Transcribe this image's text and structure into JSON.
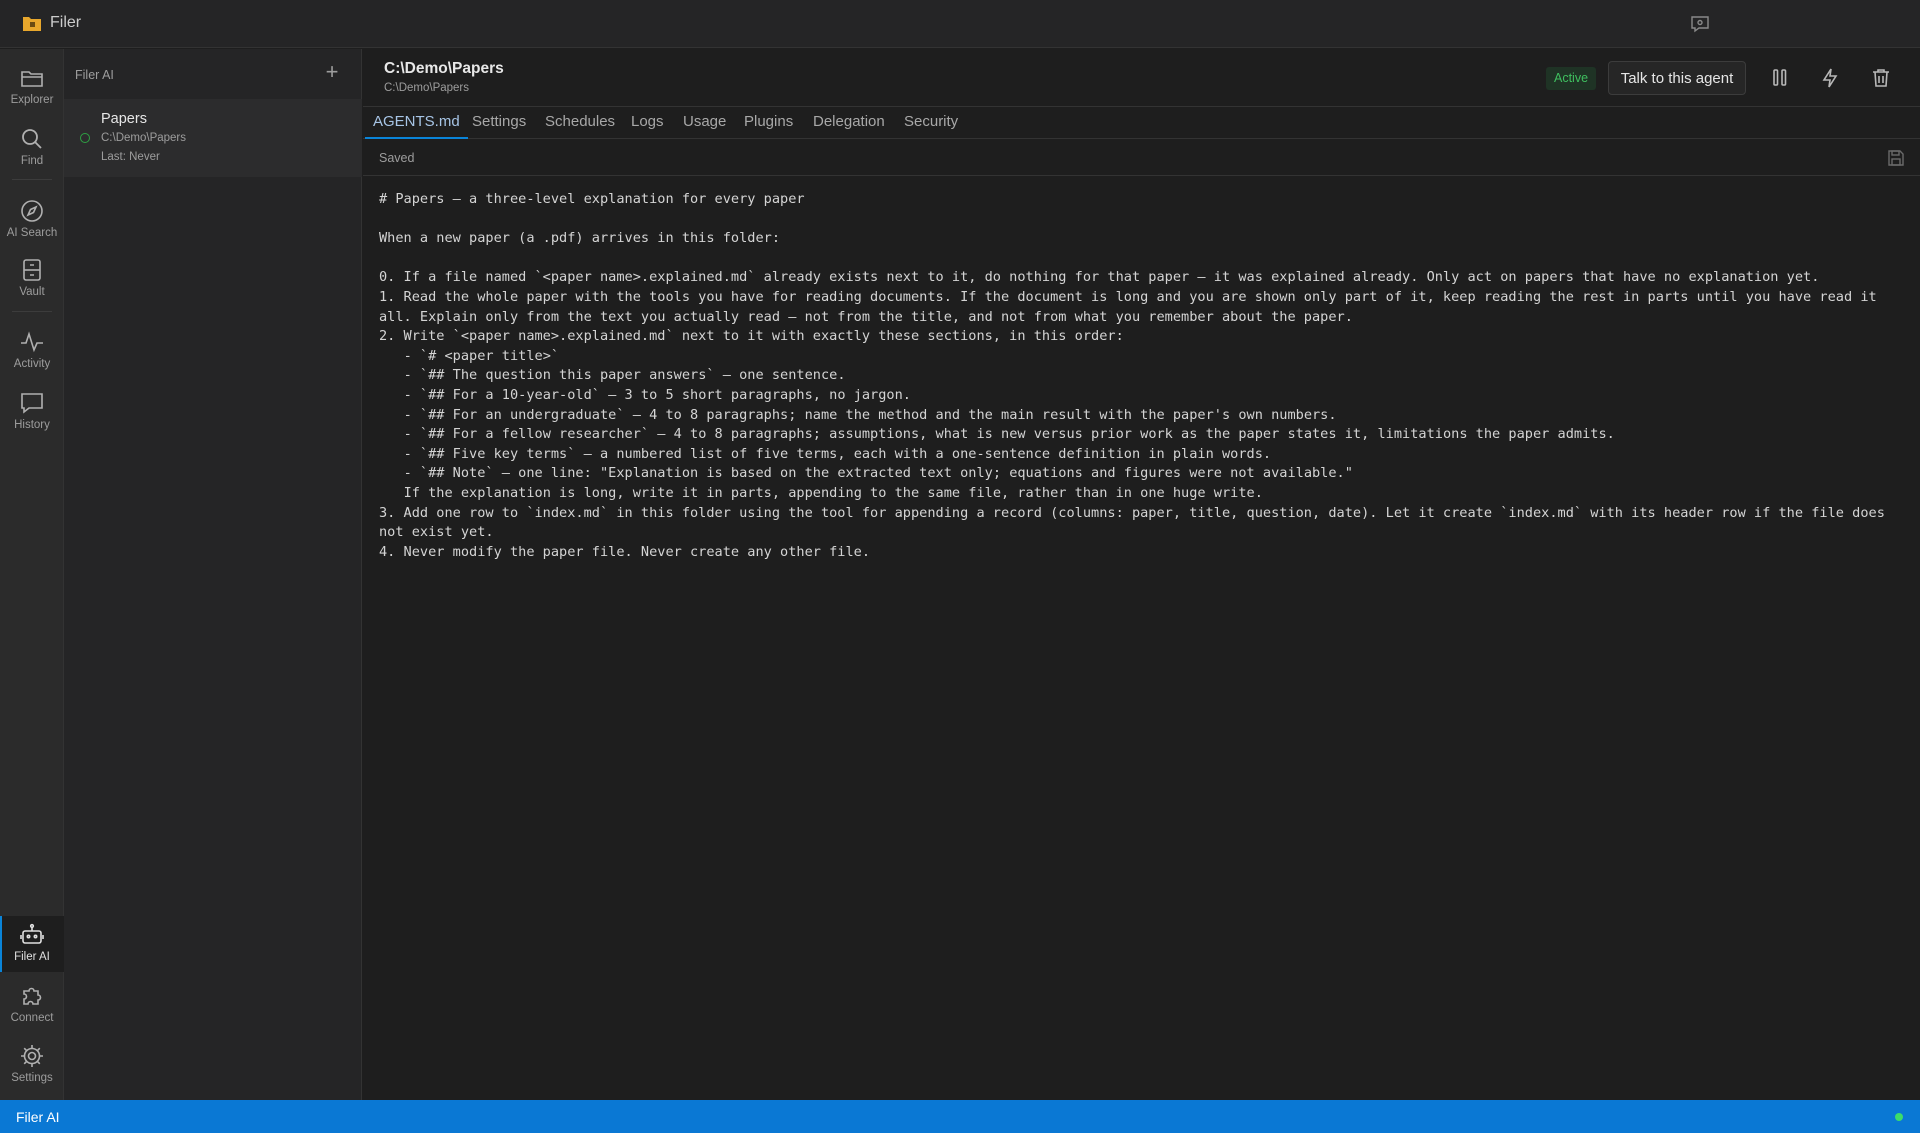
{
  "titlebar": {
    "app_title": "Filer"
  },
  "activity_bar": {
    "top": [
      {
        "id": "explorer",
        "label": "Explorer",
        "icon": "folder-icon"
      },
      {
        "id": "find",
        "label": "Find",
        "icon": "search-icon"
      },
      {
        "id": "ai-search",
        "label": "AI Search",
        "icon": "compass-icon"
      },
      {
        "id": "vault",
        "label": "Vault",
        "icon": "vault-icon"
      },
      {
        "id": "activity",
        "label": "Activity",
        "icon": "pulse-icon"
      },
      {
        "id": "history",
        "label": "History",
        "icon": "chat-bubble-icon"
      }
    ],
    "bottom": [
      {
        "id": "filer-ai",
        "label": "Filer AI",
        "icon": "robot-icon",
        "active": true
      },
      {
        "id": "connect",
        "label": "Connect",
        "icon": "puzzle-icon"
      },
      {
        "id": "settings",
        "label": "Settings",
        "icon": "gear-icon"
      }
    ]
  },
  "side_panel": {
    "title": "Filer AI",
    "add_label": "+",
    "agents": [
      {
        "name": "Papers",
        "path": "C:\\Demo\\Papers",
        "last": "Last: Never"
      }
    ]
  },
  "main": {
    "title": "C:\\Demo\\Papers",
    "subtitle": "C:\\Demo\\Papers",
    "status": "Active",
    "talk_button": "Talk to this agent",
    "tabs": [
      "AGENTS.md",
      "Settings",
      "Schedules",
      "Logs",
      "Usage",
      "Plugins",
      "Delegation",
      "Security"
    ],
    "active_tab": "AGENTS.md",
    "save_status": "Saved",
    "editor_lines": [
      "# Papers — a three-level explanation for every paper",
      "",
      "When a new paper (a .pdf) arrives in this folder:",
      "",
      "0. If a file named `<paper name>.explained.md` already exists next to it, do nothing for that paper — it was explained already. Only act on papers that have no explanation yet.",
      "1. Read the whole paper with the tools you have for reading documents. If the document is long and you are shown only part of it, keep reading the rest in parts until you have read it all. Explain only from the text you actually read — not from the title, and not from what you remember about the paper.",
      "2. Write `<paper name>.explained.md` next to it with exactly these sections, in this order:",
      "   - `# <paper title>`",
      "   - `## The question this paper answers` — one sentence.",
      "   - `## For a 10-year-old` — 3 to 5 short paragraphs, no jargon.",
      "   - `## For an undergraduate` — 4 to 8 paragraphs; name the method and the main result with the paper's own numbers.",
      "   - `## For a fellow researcher` — 4 to 8 paragraphs; assumptions, what is new versus prior work as the paper states it, limitations the paper admits.",
      "   - `## Five key terms` — a numbered list of five terms, each with a one-sentence definition in plain words.",
      "   - `## Note` — one line: \"Explanation is based on the extracted text only; equations and figures were not available.\"",
      "   If the explanation is long, write it in parts, appending to the same file, rather than in one huge write.",
      "3. Add one row to `index.md` in this folder using the tool for appending a record (columns: paper, title, question, date). Let it create `index.md` with its header row if the file does not exist yet.",
      "4. Never modify the paper file. Never create any other file."
    ]
  },
  "status_bar": {
    "text": "Filer AI"
  },
  "colors": {
    "accent": "#0a84d8",
    "status_bar": "#0a78d4",
    "active_green": "#3fbf5f"
  }
}
